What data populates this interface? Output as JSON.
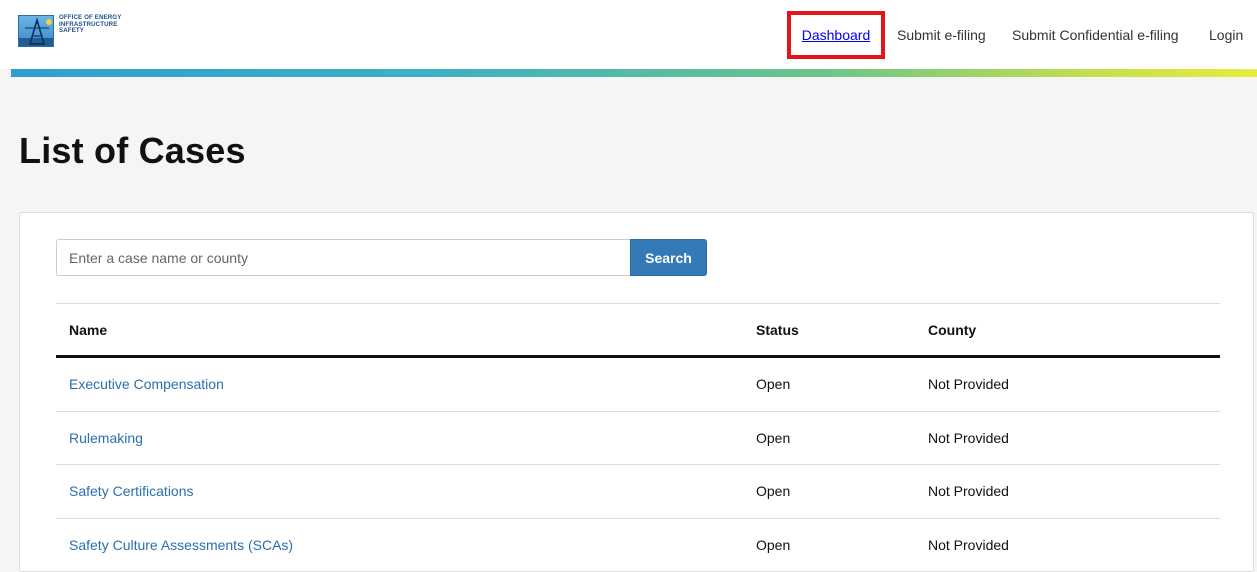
{
  "header": {
    "logo_lines": [
      "OFFICE OF ENERGY",
      "INFRASTRUCTURE",
      "SAFETY"
    ],
    "nav": {
      "dashboard": "Dashboard",
      "submit_efiling": "Submit e-filing",
      "submit_confidential": "Submit Confidential e-filing",
      "login": "Login"
    },
    "highlight_color": "#e3141b"
  },
  "page": {
    "title": "List of Cases"
  },
  "search": {
    "placeholder": "Enter a case name or county",
    "button_label": "Search"
  },
  "table": {
    "columns": [
      "Name",
      "Status",
      "County"
    ],
    "rows": [
      {
        "name": "Executive Compensation",
        "status": "Open",
        "county": "Not Provided"
      },
      {
        "name": "Rulemaking",
        "status": "Open",
        "county": "Not Provided"
      },
      {
        "name": "Safety Certifications",
        "status": "Open",
        "county": "Not Provided"
      },
      {
        "name": "Safety Culture Assessments (SCAs)",
        "status": "Open",
        "county": "Not Provided"
      }
    ]
  },
  "colors": {
    "link": "#2a6fb0",
    "button": "#337ab7"
  }
}
